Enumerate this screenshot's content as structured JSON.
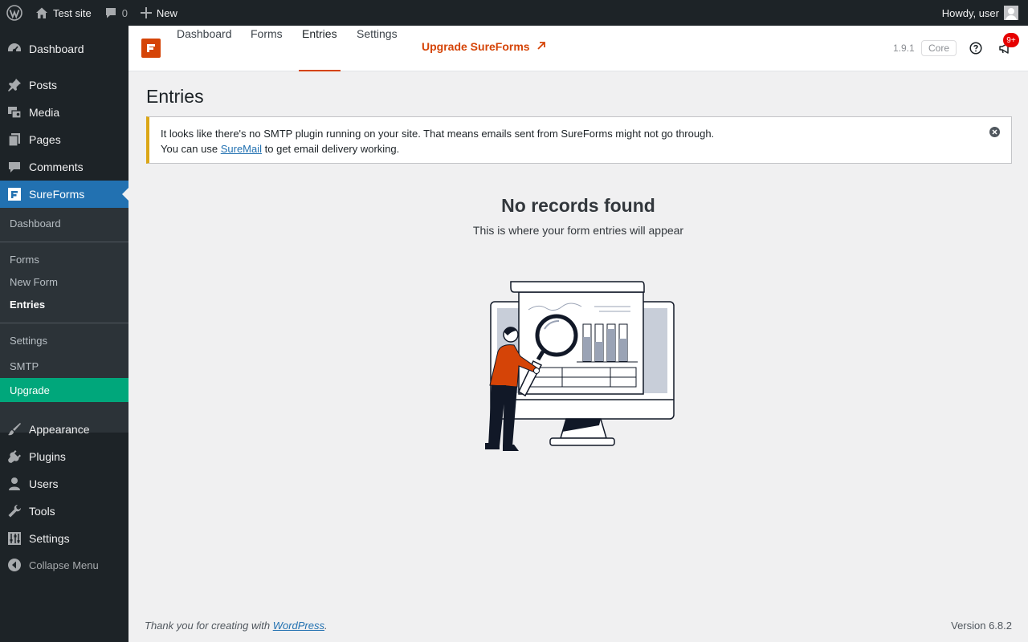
{
  "admin_bar": {
    "site_name": "Test site",
    "comments_count": "0",
    "new_label": "New",
    "greeting": "Howdy, user"
  },
  "sidebar": {
    "items": [
      {
        "label": "Dashboard",
        "icon": "dashboard-icon"
      },
      {
        "label": "Posts",
        "icon": "pin-icon"
      },
      {
        "label": "Media",
        "icon": "media-icon"
      },
      {
        "label": "Pages",
        "icon": "pages-icon"
      },
      {
        "label": "Comments",
        "icon": "comment-icon"
      },
      {
        "label": "SureForms",
        "icon": "sureforms-icon"
      },
      {
        "label": "Appearance",
        "icon": "brush-icon"
      },
      {
        "label": "Plugins",
        "icon": "plugin-icon"
      },
      {
        "label": "Users",
        "icon": "user-icon"
      },
      {
        "label": "Tools",
        "icon": "wrench-icon"
      },
      {
        "label": "Settings",
        "icon": "settings-icon"
      }
    ],
    "submenu": [
      "Dashboard",
      "Forms",
      "New Form",
      "Entries",
      "Settings",
      "SMTP",
      "Upgrade"
    ],
    "collapse_label": "Collapse Menu"
  },
  "plugin_header": {
    "tabs": [
      "Dashboard",
      "Forms",
      "Entries",
      "Settings"
    ],
    "active_tab": "Entries",
    "upgrade_label": "Upgrade SureForms",
    "version": "1.9.1",
    "edition": "Core",
    "notification_badge": "9+"
  },
  "page": {
    "title": "Entries",
    "notice": {
      "line1": "It looks like there's no SMTP plugin running on your site. That means emails sent from SureForms might not go through.",
      "line2_prefix": "You can use",
      "link": "SureMail",
      "line2_suffix": "to get email delivery working."
    },
    "empty_title": "No records found",
    "empty_description": "This is where your form entries will appear"
  },
  "footer": {
    "thanks_prefix": "Thank you for creating with",
    "thanks_link": "WordPress",
    "thanks_suffix": ".",
    "version": "Version 6.8.2"
  },
  "colors": {
    "accent": "#d54407",
    "wp_blue": "#2271b1",
    "upgrade_green": "#00a77b",
    "notice_border": "#dba617"
  }
}
